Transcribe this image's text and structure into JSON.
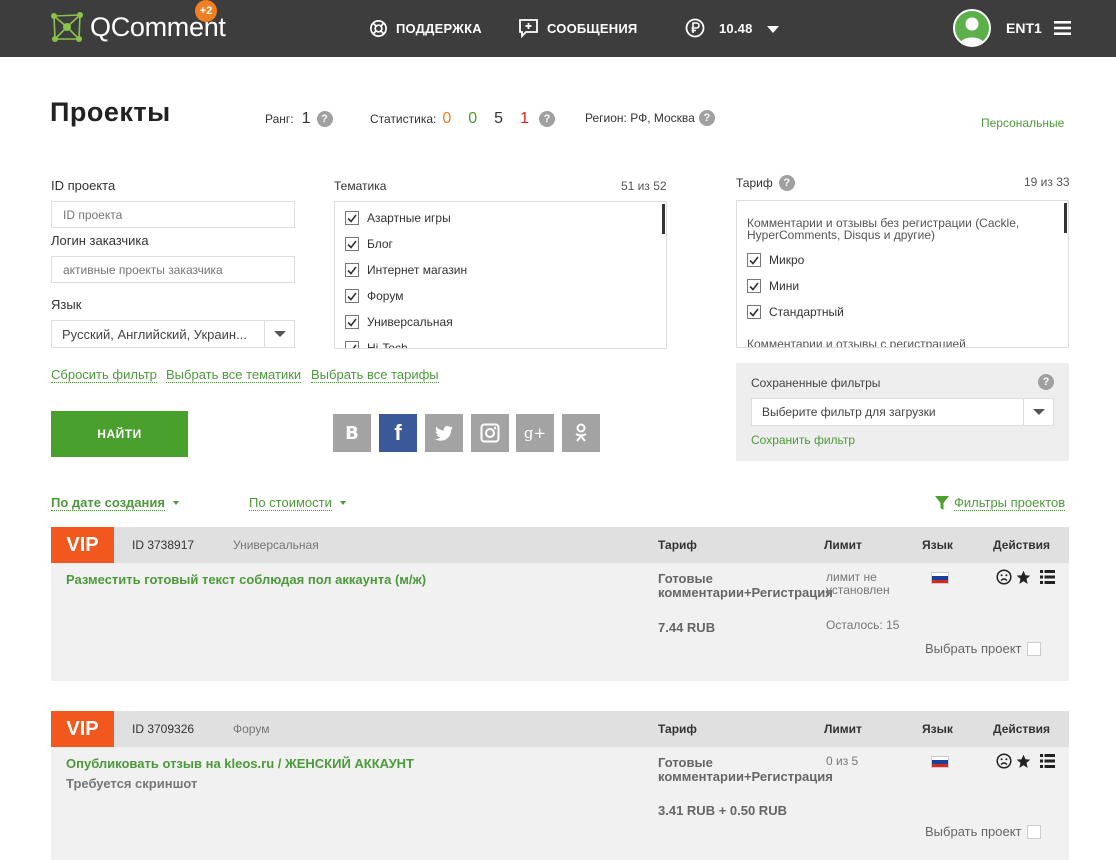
{
  "header": {
    "logo_text": "QComment",
    "logo_badge": "+2",
    "support_label": "ПОДДЕРЖКА",
    "messages_label": "СООБЩЕНИЯ",
    "balance": "10.48",
    "user_name": "ENT1"
  },
  "page": {
    "title": "Проекты",
    "rank_label": "Ранг:",
    "rank_value": "1",
    "stats_label": "Статистика:",
    "stats": [
      {
        "value": "0",
        "color": "#f07f21"
      },
      {
        "value": "0",
        "color": "#4aa02d"
      },
      {
        "value": "5",
        "color": "#333333"
      },
      {
        "value": "1",
        "color": "#d9261c"
      }
    ],
    "region_label": "Регион: РФ, Москва",
    "personal_link": "Персональные"
  },
  "filters": {
    "project_id_label": "ID проекта",
    "project_id_placeholder": "ID проекта",
    "customer_login_label": "Логин заказчика",
    "customer_login_placeholder": "активные проекты заказчика",
    "language_label": "Язык",
    "language_value": "Русский, Английский, Украин...",
    "theme_label": "Тематика",
    "theme_count": "51 из 52",
    "themes": [
      "Азартные игры",
      "Блог",
      "Интернет магазин",
      "Форум",
      "Универсальная",
      "Hi-Tech"
    ],
    "tariff_label": "Тариф",
    "tariff_count": "19 из 33",
    "tariff_group_1": "Комментарии и отзывы без регистрации (Cackle, HyperComments, Disqus и другие)",
    "tariffs": [
      "Микро",
      "Мини",
      "Стандартный"
    ],
    "tariff_group_2": "Комментарии и отзывы с регистрацией",
    "reset_link": "Сбросить фильтр",
    "select_all_themes_link": "Выбрать все тематики",
    "select_all_tariffs_link": "Выбрать все тарифы",
    "find_button": "НАЙТИ",
    "saved_filters_label": "Сохраненные фильтры",
    "saved_filters_placeholder": "Выберите фильтр для загрузки",
    "save_filter_link": "Сохранить фильтр"
  },
  "social": [
    "В",
    "f",
    "t",
    "ig",
    "g+",
    "ok"
  ],
  "sort": {
    "by_date": "По дате создания",
    "by_price": "По стоимости",
    "project_filters": "Фильтры проектов"
  },
  "columns": {
    "tariff": "Тариф",
    "limit": "Лимит",
    "language": "Язык",
    "actions": "Действия"
  },
  "projects": [
    {
      "badge": "VIP",
      "id": "ID 3738917",
      "theme": "Универсальная",
      "title": "Разместить готовый текст соблюдая пол аккаунта (м/ж)",
      "subtitle": "",
      "tariff": "Готовые комментарии+Регистрация",
      "price": "7.44 RUB",
      "limit": "лимит не установлен",
      "remaining": "Осталось: 15",
      "choose": "Выбрать проект"
    },
    {
      "badge": "VIP",
      "id": "ID 3709326",
      "theme": "Форум",
      "title": "Опубликовать отзыв на kleos.ru / ЖЕНСКИЙ АККАУНТ",
      "subtitle": "Требуется скриншот",
      "tariff": "Готовые комментарии+Регистрация",
      "price": "3.41 RUB + 0.50 RUB",
      "limit": "0 из 5",
      "remaining": "",
      "choose": "Выбрать проект"
    }
  ]
}
